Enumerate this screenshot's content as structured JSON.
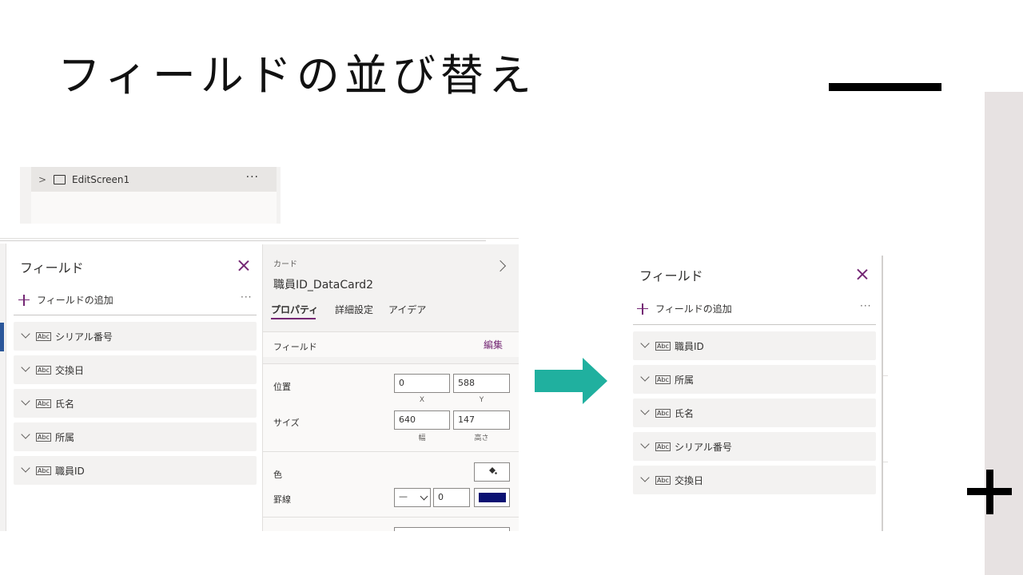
{
  "slide": {
    "title": "フィールドの並び替え"
  },
  "tree": {
    "chevron": ">",
    "screen_name": "EditScreen1",
    "more": "···"
  },
  "fields_panel_left": {
    "title": "フィールド",
    "add_label": "フィールドの追加",
    "more": "···",
    "items": [
      "シリアル番号",
      "交換日",
      "氏名",
      "所属",
      "職員ID"
    ],
    "type_badge": "Abc"
  },
  "card_panel": {
    "kind_label": "カード",
    "card_name": "職員ID_DataCard2",
    "tabs": [
      "プロパティ",
      "詳細設定",
      "アイデア"
    ],
    "fields_label": "フィールド",
    "edit_label": "編集",
    "position": {
      "label": "位置",
      "x": "0",
      "y": "588",
      "x_caption": "X",
      "y_caption": "Y"
    },
    "size": {
      "label": "サイズ",
      "width": "640",
      "height": "147",
      "width_caption": "幅",
      "height_caption": "高さ"
    },
    "color": {
      "label": "色",
      "fill_icon": "paint-bucket-icon"
    },
    "border": {
      "label": "罫線",
      "style": "—",
      "thickness": "0",
      "swatch_color": "#0a1172"
    }
  },
  "fields_panel_right": {
    "title": "フィールド",
    "add_label": "フィールドの追加",
    "more": "···",
    "items": [
      "職員ID",
      "所属",
      "氏名",
      "シリアル番号",
      "交換日"
    ],
    "type_badge": "Abc"
  },
  "colors": {
    "accent": "#742774",
    "arrow": "#20b09f",
    "panel_bg": "#f3f2f1"
  }
}
